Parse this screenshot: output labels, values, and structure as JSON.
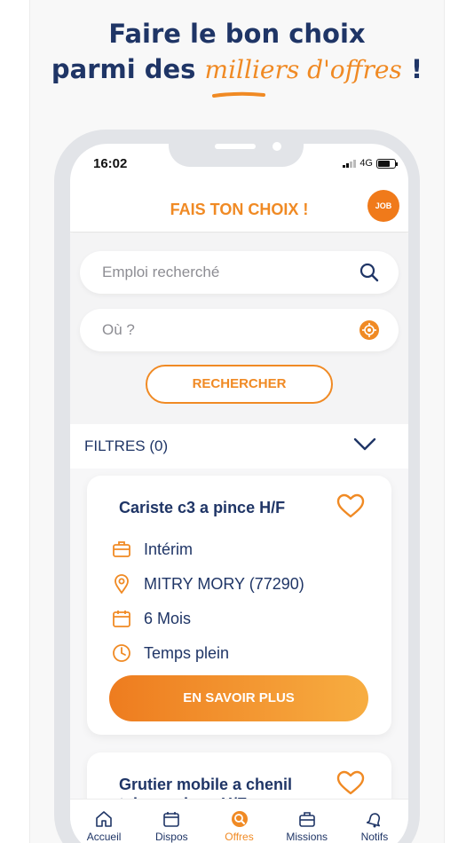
{
  "headline": {
    "line1": "Faire le bon choix",
    "line2_pre": "parmi des ",
    "line2_accent": "milliers d'offres",
    "line2_post": " !"
  },
  "status": {
    "time": "16:02",
    "network": "4G"
  },
  "header": {
    "title": "FAIS TON CHOIX !",
    "badge": "JOB"
  },
  "search": {
    "job_placeholder": "Emploi recherché",
    "location_placeholder": "Où ?",
    "button_label": "RECHERCHER"
  },
  "filters": {
    "label": "FILTRES (0)"
  },
  "offers": [
    {
      "title": "Cariste c3 a pince H/F",
      "contract": "Intérim",
      "location": "MITRY MORY (77290)",
      "duration": "6 Mois",
      "schedule": "Temps plein",
      "cta": "EN SAVOIR PLUS"
    },
    {
      "title": "Grutier mobile a chenil telescopique H/F"
    }
  ],
  "tabs": [
    {
      "label": "Accueil",
      "icon": "home-icon"
    },
    {
      "label": "Dispos",
      "icon": "calendar-icon"
    },
    {
      "label": "Offres",
      "icon": "search-icon"
    },
    {
      "label": "Missions",
      "icon": "briefcase-icon"
    },
    {
      "label": "Notifs",
      "icon": "bell-icon"
    }
  ],
  "colors": {
    "accent": "#f08a24",
    "navy": "#1f3566"
  }
}
